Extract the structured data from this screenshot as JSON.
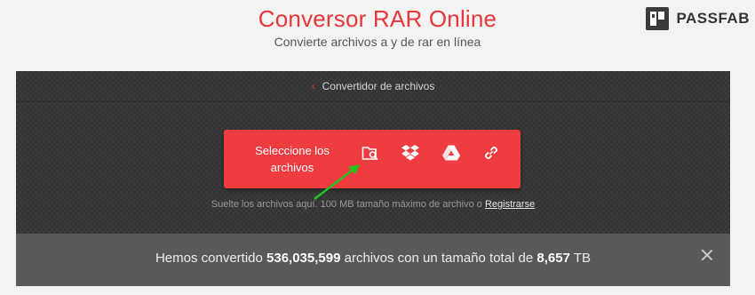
{
  "header": {
    "title": "Conversor RAR Online",
    "subtitle": "Convierte archivos a y de rar en línea"
  },
  "brand": {
    "name": "PASSFAB",
    "icon": "passfab-logo"
  },
  "breadcrumb": {
    "label": "Convertidor de archivos"
  },
  "upload": {
    "label": "Seleccione los archivos",
    "icons": [
      "folder-search-icon",
      "dropbox-icon",
      "google-drive-icon",
      "link-icon"
    ]
  },
  "hint": {
    "text": "Suelte los archivos aquí. 100 MB tamaño máximo de archivo o",
    "link": "Registrarse"
  },
  "stats": {
    "prefix": "Hemos convertido",
    "files": "536,035,599",
    "middle": "archivos con un tamaño total de",
    "size": "8,657",
    "unit": "TB"
  },
  "colors": {
    "accent": "#ef3c40",
    "title": "#e8363a",
    "arrow": "#22c51d"
  }
}
